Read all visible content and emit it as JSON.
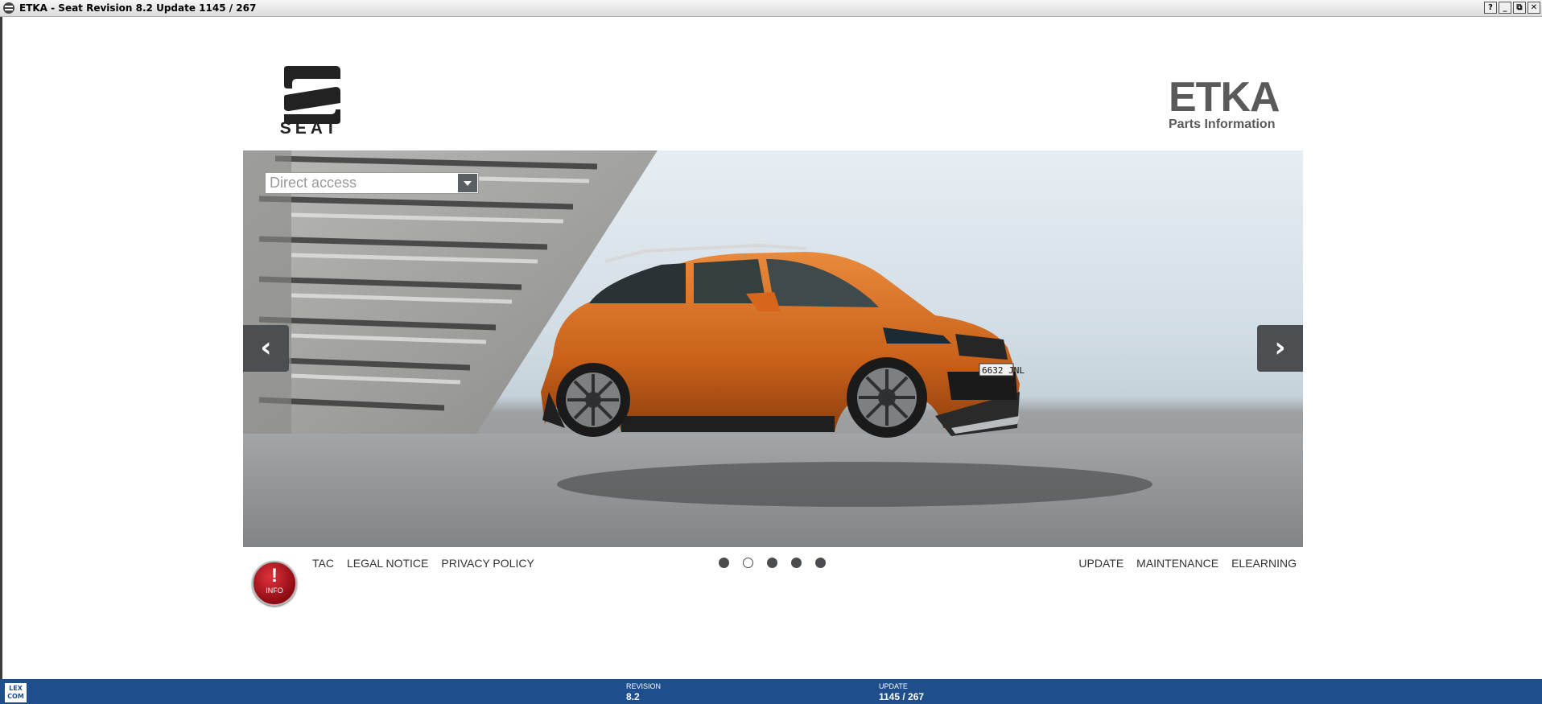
{
  "window": {
    "title": "ETKA - Seat Revision 8.2 Update 1145 / 267",
    "buttons": {
      "help": "?",
      "minimize": "_",
      "restore": "⧉",
      "close": "✕"
    }
  },
  "logos": {
    "brand": "SEAT",
    "product": "ETKA",
    "product_sub": "Parts Information"
  },
  "search": {
    "placeholder": "Direct access",
    "value": ""
  },
  "carousel": {
    "prev": "‹",
    "next": "›",
    "slide_count": 5,
    "active_slide": 2,
    "plate": "6632 JNL"
  },
  "info_button": {
    "mark": "!",
    "label": "INFO"
  },
  "links_left": [
    "TAC",
    "LEGAL NOTICE",
    "PRIVACY POLICY"
  ],
  "links_right": [
    "UPDATE",
    "MAINTENANCE",
    "ELEARNING"
  ],
  "statusbar": {
    "logo": "LEX COM",
    "revision_label": "REVISION",
    "revision_value": "8.2",
    "update_label": "UPDATE",
    "update_value": "1145 / 267"
  },
  "colors": {
    "statusbar": "#1e4f8c",
    "info_red": "#b5141c",
    "car_orange": "#d9691e",
    "control_gray": "#4c4f52"
  }
}
